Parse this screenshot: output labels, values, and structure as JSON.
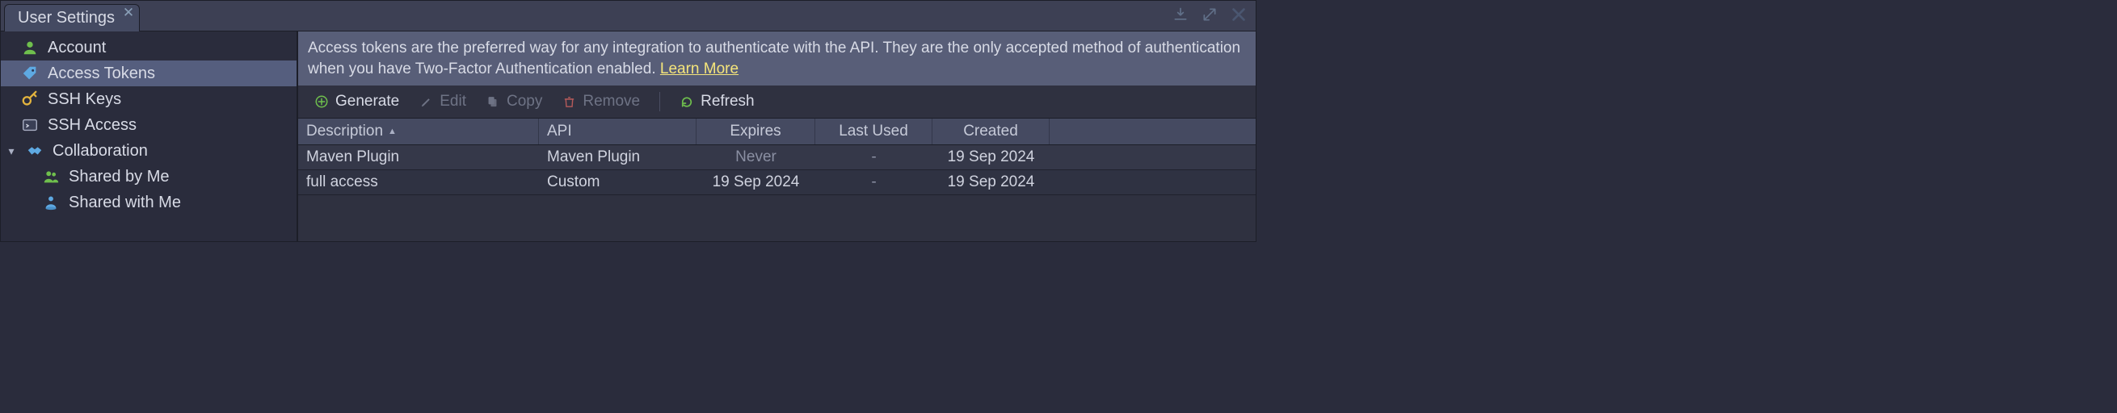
{
  "tab": {
    "title": "User Settings"
  },
  "sidebar": {
    "items": [
      {
        "label": "Account"
      },
      {
        "label": "Access Tokens"
      },
      {
        "label": "SSH Keys"
      },
      {
        "label": "SSH Access"
      },
      {
        "label": "Collaboration"
      },
      {
        "label": "Shared by Me"
      },
      {
        "label": "Shared with Me"
      }
    ]
  },
  "banner": {
    "text": "Access tokens are the preferred way for any integration to authenticate with the API. They are the only accepted method of authentication when you have Two-Factor Authentication enabled. ",
    "link": "Learn More"
  },
  "toolbar": {
    "generate": "Generate",
    "edit": "Edit",
    "copy": "Copy",
    "remove": "Remove",
    "refresh": "Refresh"
  },
  "table": {
    "headers": {
      "description": "Description",
      "api": "API",
      "expires": "Expires",
      "last_used": "Last Used",
      "created": "Created"
    },
    "rows": [
      {
        "description": "Maven Plugin",
        "api": "Maven Plugin",
        "expires": "Never",
        "last_used": "-",
        "created": "19 Sep 2024"
      },
      {
        "description": "full access",
        "api": "Custom",
        "expires": "19 Sep 2024",
        "last_used": "-",
        "created": "19 Sep 2024"
      }
    ]
  }
}
